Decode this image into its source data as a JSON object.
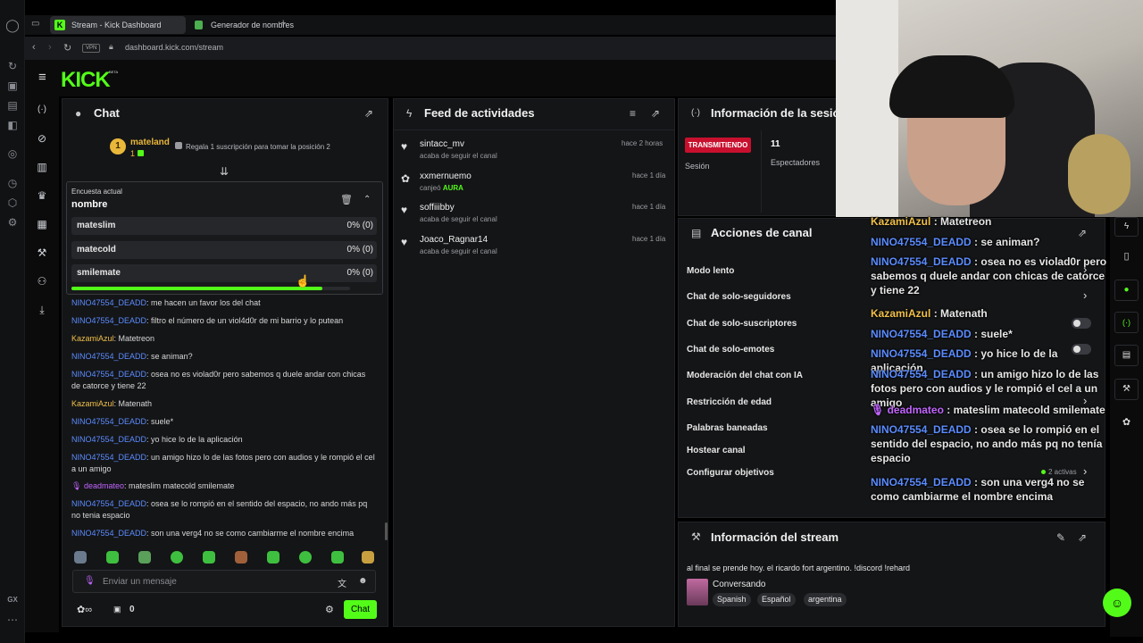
{
  "browser": {
    "tabs": [
      {
        "label": "Stream - Kick Dashboard"
      },
      {
        "label": "Generador de nombres de"
      }
    ],
    "new_tab": "+",
    "vpn": "VPN",
    "url": "dashboard.kick.com/stream",
    "bottom_label": "GX"
  },
  "kick": {
    "logo": "KICK",
    "beta": "BETA"
  },
  "chat": {
    "title": "Chat",
    "top_gifter": {
      "rank": "1",
      "name": "mateland",
      "count": "1"
    },
    "gift_prompt": "Regala 1 suscripción para tomar la posición 2",
    "poll": {
      "heading": "Encuesta actual",
      "question": "nombre",
      "options": [
        {
          "label": "mateslim",
          "result": "0% (0)"
        },
        {
          "label": "matecold",
          "result": "0% (0)"
        },
        {
          "label": "smilemate",
          "result": "0% (0)"
        }
      ],
      "progress": 0.9
    },
    "messages": [
      {
        "user": "NINO47554_DEADD",
        "text": ": me hacen un favor los del chat"
      },
      {
        "user": "NINO47554_DEADD",
        "text": ": filtro el número de un viol4d0r de mi barrio y lo putean"
      },
      {
        "user": "KazamiAzul",
        "text": ": Matetreon"
      },
      {
        "user": "NINO47554_DEADD",
        "text": ": se animan?"
      },
      {
        "user": "NINO47554_DEADD",
        "text": ": osea no es violad0r pero sabemos q duele andar con chicas de catorce y tiene 22"
      },
      {
        "user": "KazamiAzul",
        "text": ": Matenath"
      },
      {
        "user": "NINO47554_DEADD",
        "text": ": suele*"
      },
      {
        "user": "NINO47554_DEADD",
        "text": ": yo hice lo de la aplicación"
      },
      {
        "user": "NINO47554_DEADD",
        "text": ": un amigo hizo lo de las fotos pero con audios y le rompió el cel a un amigo"
      },
      {
        "user": "deadmateo",
        "text": ": mateslim matecold smilemate"
      },
      {
        "user": "NINO47554_DEADD",
        "text": ": osea se lo rompió en el sentido del espacio, no ando más pq no tenia espacio"
      },
      {
        "user": "NINO47554_DEADD",
        "text": ": son una verg4 no se como cambiarme el nombre encima"
      }
    ],
    "input_placeholder": "Enviar un mensaje",
    "points": "0",
    "send_button": "Chat"
  },
  "activity": {
    "title": "Feed de actividades",
    "items": [
      {
        "name": "sintacc_mv",
        "sub": "acaba de seguir el canal",
        "time": "hace 2 horas"
      },
      {
        "name": "xxmernuemo",
        "sub": "canjeó",
        "sub_highlight": "AURA",
        "time": "hace 1 día"
      },
      {
        "name": "soffiiibby",
        "sub": "acaba de seguir el canal",
        "time": "hace 1 día"
      },
      {
        "name": "Joaco_Ragnar14",
        "sub": "acaba de seguir el canal",
        "time": "hace 1 día"
      }
    ]
  },
  "session": {
    "title": "Información de la sesión",
    "live_badge": "TRANSMITIENDO",
    "session_label": "Sesión",
    "viewers": "11",
    "viewers_label": "Espectadores"
  },
  "channel_actions": {
    "title": "Acciones de canal",
    "items": [
      {
        "label": "Modo lento"
      },
      {
        "label": "Chat de solo-seguidores"
      },
      {
        "label": "Chat de solo-suscriptores"
      },
      {
        "label": "Chat de solo-emotes"
      },
      {
        "label": "Moderación del chat con IA"
      },
      {
        "label": "Restricción de edad"
      },
      {
        "label": "Palabras baneadas"
      },
      {
        "label": "Hostear canal"
      },
      {
        "label": "Configurar objetivos"
      }
    ],
    "goals_active": "2 activas"
  },
  "stream_info": {
    "title": "Información del stream",
    "stream_title": "al final se prende hoy. el ricardo fort argentino. !discord !rehard",
    "category": "Conversando",
    "tags": [
      "Spanish",
      "Español",
      "argentina"
    ]
  },
  "chat_overlay": {
    "messages": [
      {
        "user": "KazamiAzul",
        "text": " : Matetreon"
      },
      {
        "user": "NINO47554_DEADD",
        "text": " : se animan?"
      },
      {
        "user": "NINO47554_DEADD",
        "text": " : osea no es violad0r pero sabemos q duele andar con chicas de catorce y tiene 22"
      },
      {
        "user": "KazamiAzul",
        "text": " : Matenath"
      },
      {
        "user": "NINO47554_DEADD",
        "text": " : suele*"
      },
      {
        "user": "NINO47554_DEADD",
        "text": " : yo hice lo de la aplicación"
      },
      {
        "user": "NINO47554_DEADD",
        "text": " : un amigo hizo lo de las fotos pero con audios y le rompió el cel a un amigo"
      },
      {
        "user": "deadmateo",
        "text": " : mateslim matecold smilemate"
      },
      {
        "user": "NINO47554_DEADD",
        "text": " : osea se lo rompió en el sentido del espacio, no ando más pq no tenía espacio"
      },
      {
        "user": "NINO47554_DEADD",
        "text": " : son una verg4 no se como cambiarme el nombre encima"
      }
    ]
  },
  "colors": {
    "accent": "#53fc18",
    "live": "#c8102e",
    "username_blue": "#5b8cff",
    "username_gold": "#f0c04a",
    "username_purple": "#c165ff"
  }
}
